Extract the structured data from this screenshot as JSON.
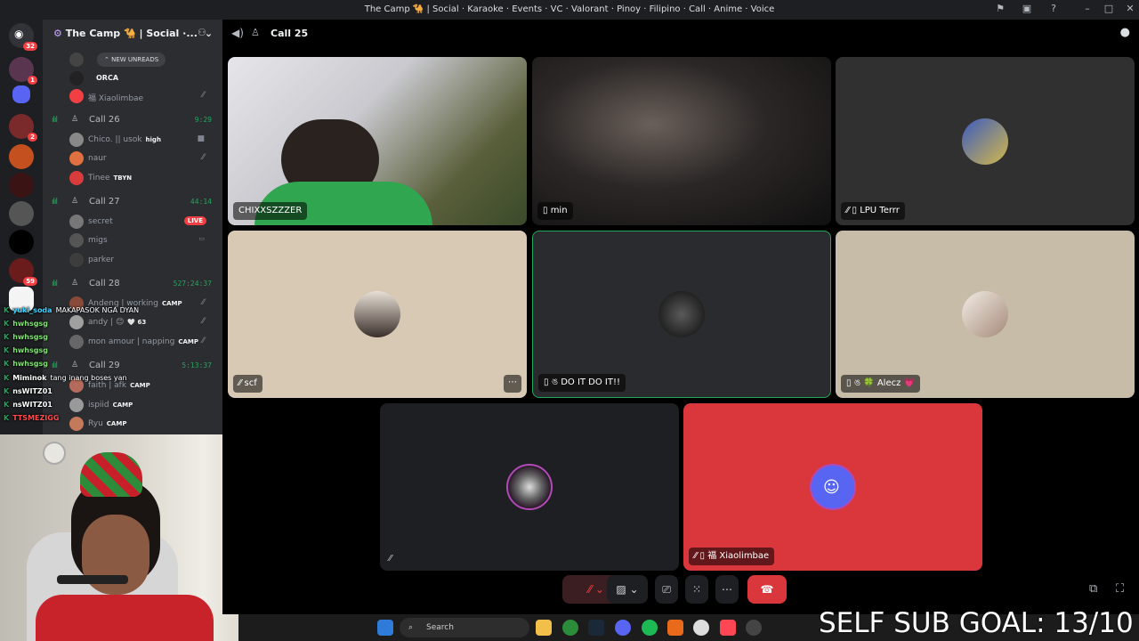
{
  "window": {
    "title": "The Camp 🐪 | Social · Karaoke · Events · VC · Valorant · Pinoy · Filipino · Call · Anime · Voice"
  },
  "rail": {
    "home_badge": "32",
    "badges": [
      "1",
      "2",
      "59"
    ]
  },
  "sidebar": {
    "server_name": "The Camp 🐪 | Social ·...",
    "new_unreads": "NEW UNREADS",
    "top_members": [
      {
        "name": "ORCA",
        "tag": ""
      },
      {
        "name": "福 Xiaolimbae",
        "tag": ""
      }
    ],
    "channels": [
      {
        "name": "Call 26",
        "time": "9:29",
        "members": [
          {
            "name": "Chico. || usok",
            "tag": "high"
          },
          {
            "name": "naur",
            "tag": ""
          },
          {
            "name": "Tinee",
            "tag": "TBYN"
          }
        ]
      },
      {
        "name": "Call 27",
        "time": "44:14",
        "live": "LIVE",
        "members": [
          {
            "name": "secret",
            "tag": ""
          },
          {
            "name": "migs",
            "tag": ""
          },
          {
            "name": "parker",
            "tag": ""
          }
        ]
      },
      {
        "name": "Call 28",
        "time": "527:24:37",
        "members": [
          {
            "name": "Andeng | working",
            "tag": "CAMP"
          },
          {
            "name": "andy | 😊",
            "tag": "🤍 63"
          },
          {
            "name": "mon amour | napping",
            "tag": "CAMP"
          }
        ]
      },
      {
        "name": "Call 29",
        "time": "5:13:37",
        "members": [
          {
            "name": "faith | afk",
            "tag": "CAMP"
          },
          {
            "name": "ispiid",
            "tag": "CAMP"
          },
          {
            "name": "Ryu",
            "tag": "CAMP"
          }
        ]
      }
    ]
  },
  "chat": [
    {
      "user": "yuki_soda",
      "text": "MAKAPASOK NGA DYAN"
    },
    {
      "user": "hwhsgsg",
      "text": ""
    },
    {
      "user": "hwhsgsg",
      "text": ""
    },
    {
      "user": "hwhsgsg",
      "text": ""
    },
    {
      "user": "hwhsgsg",
      "text": ""
    },
    {
      "user": "Miminok",
      "text": "tang inang boses yan"
    },
    {
      "user": "nsWITZ01",
      "text": ""
    },
    {
      "user": "nsWITZ01",
      "text": ""
    },
    {
      "user": "TTSMEZIGG",
      "text": ""
    }
  ],
  "call": {
    "title": "Call 25",
    "tiles": [
      {
        "name": "CHIXXSZZZER"
      },
      {
        "name": "min"
      },
      {
        "name": "LPU Terrr"
      },
      {
        "name": "scf"
      },
      {
        "name": "ঙ DO IT DO IT!!"
      },
      {
        "name": "ঙ 🍀 Alecz 💗"
      },
      {
        "name": ""
      },
      {
        "name": "福 Xiaolimbae"
      }
    ]
  },
  "taskbar": {
    "search_placeholder": "Search"
  },
  "overlay": {
    "goal_text": "SELF SUB GOAL: 13/10"
  },
  "colors": {
    "accent_green": "#23a55a",
    "danger_red": "#da373c",
    "tile_beige": "#d8c9b5",
    "tile_gray": "#2a2b2e"
  }
}
